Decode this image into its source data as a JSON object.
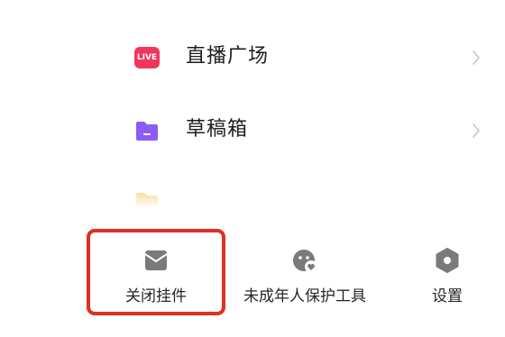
{
  "menu": {
    "items": [
      {
        "label": "直播广场",
        "icon": "live-icon",
        "icon_text": "LIVE",
        "icon_color": "#f0365a"
      },
      {
        "label": "草稿箱",
        "icon": "folder-icon",
        "icon_color": "#8b5cf6"
      }
    ]
  },
  "tools": {
    "items": [
      {
        "label": "关闭挂件",
        "icon": "widget-box-icon"
      },
      {
        "label": "未成年人保护工具",
        "icon": "minor-protection-icon"
      },
      {
        "label": "设置",
        "icon": "settings-hexagon-icon"
      }
    ],
    "highlight_color": "#e0301e",
    "highlighted_item": "关闭挂件"
  }
}
